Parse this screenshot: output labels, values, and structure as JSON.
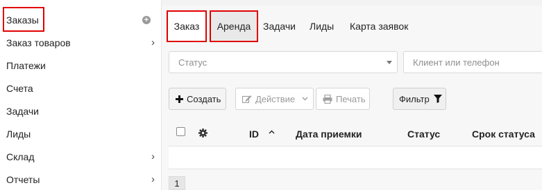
{
  "sidebar": {
    "items": [
      {
        "label": "Заказы",
        "active": true,
        "icon": "plus-circle-icon"
      },
      {
        "label": "Заказ товаров",
        "icon": "chevron-right-icon"
      },
      {
        "label": "Платежи"
      },
      {
        "label": "Счета"
      },
      {
        "label": "Задачи"
      },
      {
        "label": "Лиды"
      },
      {
        "label": "Склад",
        "icon": "chevron-right-icon"
      },
      {
        "label": "Отчеты",
        "icon": "chevron-right-icon"
      }
    ]
  },
  "tabs": [
    {
      "label": "Заказ",
      "state": "selected"
    },
    {
      "label": "Аренда",
      "state": "highlighted"
    },
    {
      "label": "Задачи"
    },
    {
      "label": "Лиды"
    },
    {
      "label": "Карта заявок"
    }
  ],
  "filters": {
    "status_placeholder": "Статус",
    "client_placeholder": "Клиент или телефон"
  },
  "toolbar": {
    "create_label": "Создать",
    "action_label": "Действие",
    "print_label": "Печать",
    "filter_label": "Фильтр"
  },
  "table": {
    "columns": [
      "ID",
      "Дата приемки",
      "Статус",
      "Срок статуса"
    ],
    "sort_column": "ID",
    "sort_direction": "ascending"
  },
  "pagination": {
    "current_page": "1"
  },
  "colors": {
    "highlight_border": "#e00000",
    "page_background": "#f7f7f7"
  }
}
